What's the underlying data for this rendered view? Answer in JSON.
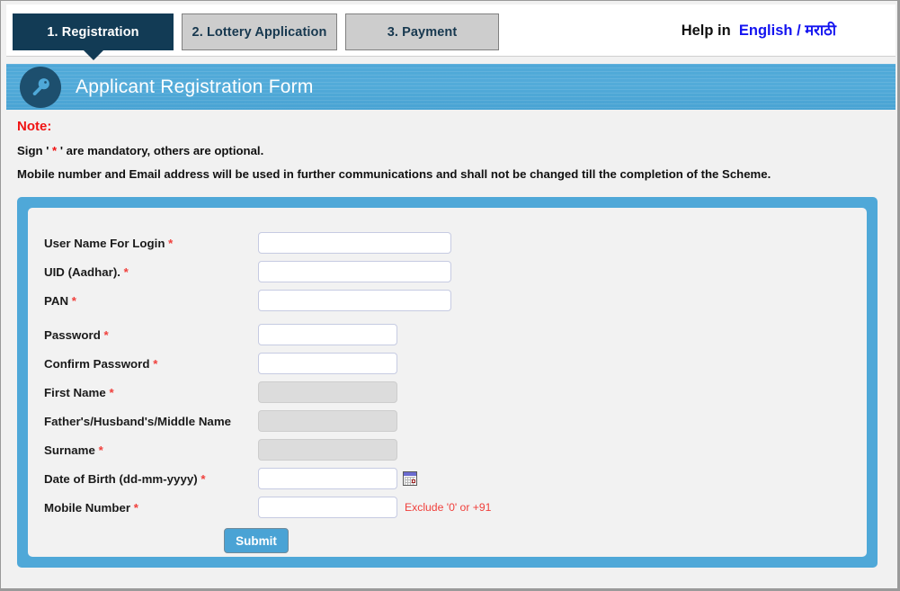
{
  "tabs": [
    {
      "label": "1. Registration",
      "active": true
    },
    {
      "label": "2. Lottery Application",
      "active": false
    },
    {
      "label": "3. Payment",
      "active": false
    }
  ],
  "help": {
    "prefix": "Help in",
    "english": "English",
    "separator": "/",
    "marathi": "मराठी"
  },
  "banner": {
    "title": "Applicant Registration Form",
    "icon": "key-icon",
    "accent_color": "#4fa8d8",
    "icon_circle_color": "#1d4f6e"
  },
  "note": {
    "heading": "Note:",
    "line1_before": "Sign ' ",
    "line1_star": "*",
    "line1_after": " ' are mandatory, others are optional.",
    "line2": "Mobile number and Email address will be used in further communications and shall not be changed till the completion of the Scheme.",
    "heading_color": "#f01414"
  },
  "form": {
    "fields": [
      {
        "label": "User Name For Login",
        "required": true,
        "value": "",
        "placeholder": "",
        "width": "wide",
        "disabled": false
      },
      {
        "label": "UID (Aadhar).",
        "required": true,
        "value": "",
        "placeholder": "",
        "width": "wide",
        "disabled": false
      },
      {
        "label": "PAN",
        "required": true,
        "value": "",
        "placeholder": "",
        "width": "wide",
        "disabled": false
      },
      {
        "label": "Password",
        "required": true,
        "value": "",
        "placeholder": "",
        "width": "mid",
        "disabled": false
      },
      {
        "label": "Confirm Password",
        "required": true,
        "value": "",
        "placeholder": "",
        "width": "mid",
        "disabled": false
      },
      {
        "label": "First Name",
        "required": true,
        "value": "",
        "placeholder": "",
        "width": "mid",
        "disabled": true
      },
      {
        "label": "Father's/Husband's/Middle Name",
        "required": false,
        "value": "",
        "placeholder": "",
        "width": "mid",
        "disabled": true
      },
      {
        "label": "Surname",
        "required": true,
        "value": "",
        "placeholder": "",
        "width": "mid",
        "disabled": true
      },
      {
        "label": "Date of Birth (dd-mm-yyyy)",
        "required": true,
        "value": "",
        "placeholder": "",
        "width": "mid",
        "disabled": false,
        "calendar": true
      },
      {
        "label": "Mobile Number",
        "required": true,
        "value": "",
        "placeholder": "",
        "width": "mid",
        "disabled": false,
        "hint": "Exclude '0' or +91"
      }
    ],
    "submit_label": "Submit",
    "required_marker": "*"
  }
}
